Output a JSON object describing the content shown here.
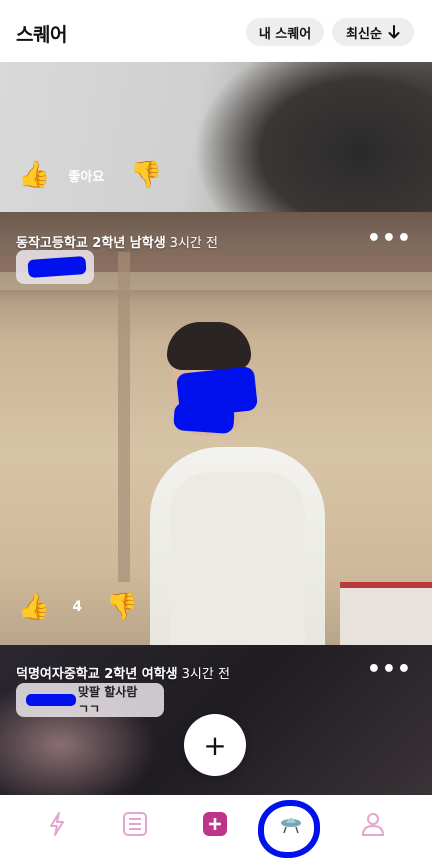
{
  "header": {
    "title": "스퀘어",
    "my_square_label": "내 스퀘어",
    "sort_label": "최신순"
  },
  "posts": [
    {
      "react_label": "좋아요"
    },
    {
      "poster": "동작고등학교 2학년 남학생",
      "time": "3시간 전",
      "tag_text": "",
      "like_count": "4"
    },
    {
      "poster": "덕명여자중학교 2학년 여학생",
      "time": "3시간 전",
      "tag_text": "맞팔 할사람 ㄱㄱ"
    }
  ],
  "icons": {
    "more": "more-dots-icon",
    "thumb_up": "thumbs-up-icon",
    "thumb_down": "thumbs-down-icon",
    "sort_arrow": "arrow-down-icon",
    "fab": "plus-icon"
  },
  "nav": {
    "items": [
      "lightning-icon",
      "list-icon",
      "add-post-icon",
      "square-icon",
      "profile-icon"
    ]
  },
  "colors": {
    "accent": "#c0338a",
    "nav_inactive": "#e3a6cf"
  }
}
